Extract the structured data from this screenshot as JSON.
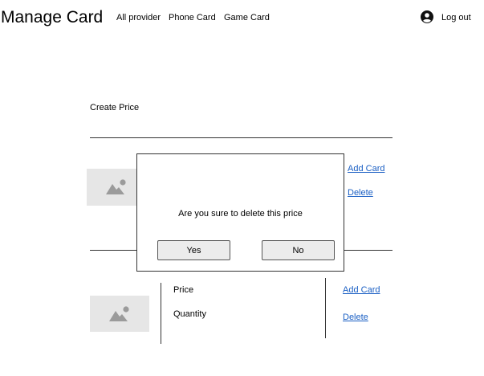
{
  "header": {
    "title": "Manage Card",
    "nav": [
      "All provider",
      "Phone Card",
      "Game Card"
    ],
    "logout_label": "Log out",
    "user_icon": "user-circle-icon"
  },
  "main": {
    "create_price_label": "Create Price",
    "card_row_1": {
      "image_icon": "image-placeholder-icon",
      "add_card_label": "Add Card",
      "delete_label": "Delete"
    },
    "card_row_2": {
      "image_icon": "image-placeholder-icon",
      "price_label": "Price",
      "quantity_label": "Quantity",
      "add_card_label": "Add Card",
      "delete_label": "Delete"
    }
  },
  "dialog": {
    "message": "Are you sure to delete this price",
    "yes_label": "Yes",
    "no_label": "No"
  },
  "colors": {
    "link": "#1a5fc4",
    "placeholder_bg": "#e6e6e6",
    "placeholder_icon": "#9b9b9b"
  }
}
